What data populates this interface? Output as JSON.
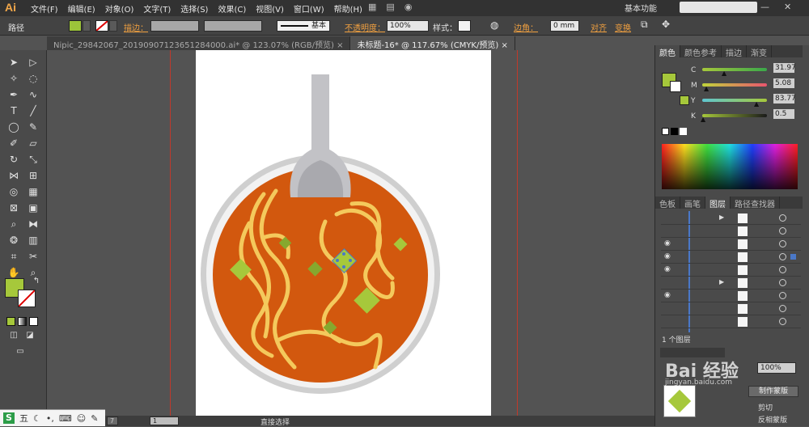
{
  "app": {
    "logo": "Ai",
    "workspace": "基本功能"
  },
  "menu": [
    "文件(F)",
    "编辑(E)",
    "对象(O)",
    "文字(T)",
    "选择(S)",
    "效果(C)",
    "视图(V)",
    "窗口(W)",
    "帮助(H)"
  ],
  "control": {
    "object_type": "路径",
    "stroke_label": "描边：",
    "stroke_style": "基本",
    "opacity_label": "不透明度：",
    "opacity_value": "100%",
    "style_label": "样式：",
    "corner_label": "边角：",
    "corner_value": "0 mm",
    "align_label": "对齐",
    "transform_label": "变换",
    "fill_color": "#9cc43a"
  },
  "tabs": [
    {
      "label": "Nipic_29842067_20190907123651284000.ai* @ 123.07% (RGB/预览)",
      "active": false
    },
    {
      "label": "未标题-16* @ 117.67% (CMYK/预览)",
      "active": true
    }
  ],
  "color_panel": {
    "tabs": [
      "颜色",
      "颜色参考",
      "描边",
      "渐变"
    ],
    "channels": [
      {
        "label": "C",
        "value": "31.97",
        "fraction": 0.32
      },
      {
        "label": "M",
        "value": "5.08",
        "fraction": 0.05
      },
      {
        "label": "Y",
        "value": "83.77",
        "fraction": 0.84
      },
      {
        "label": "K",
        "value": "0.5",
        "fraction": 0.01
      }
    ],
    "swatch_color": "#a6c83b"
  },
  "layers_panel": {
    "tabs": [
      "色板",
      "画笔",
      "图层",
      "路径查找器"
    ],
    "footer": "1 个图层"
  },
  "lower_panel": {
    "opacity_value": "100%",
    "make_mask_button": "制作蒙版",
    "clip_label": "剪切",
    "invert_label": "反相蒙版"
  },
  "watermark": "Bai 经验",
  "watermark_sub": "jingyan.baidu.com",
  "status": {
    "zoom": "117.67%",
    "page": "1",
    "tool": "直接选择"
  },
  "taskbar": {
    "ime_label": "五"
  }
}
